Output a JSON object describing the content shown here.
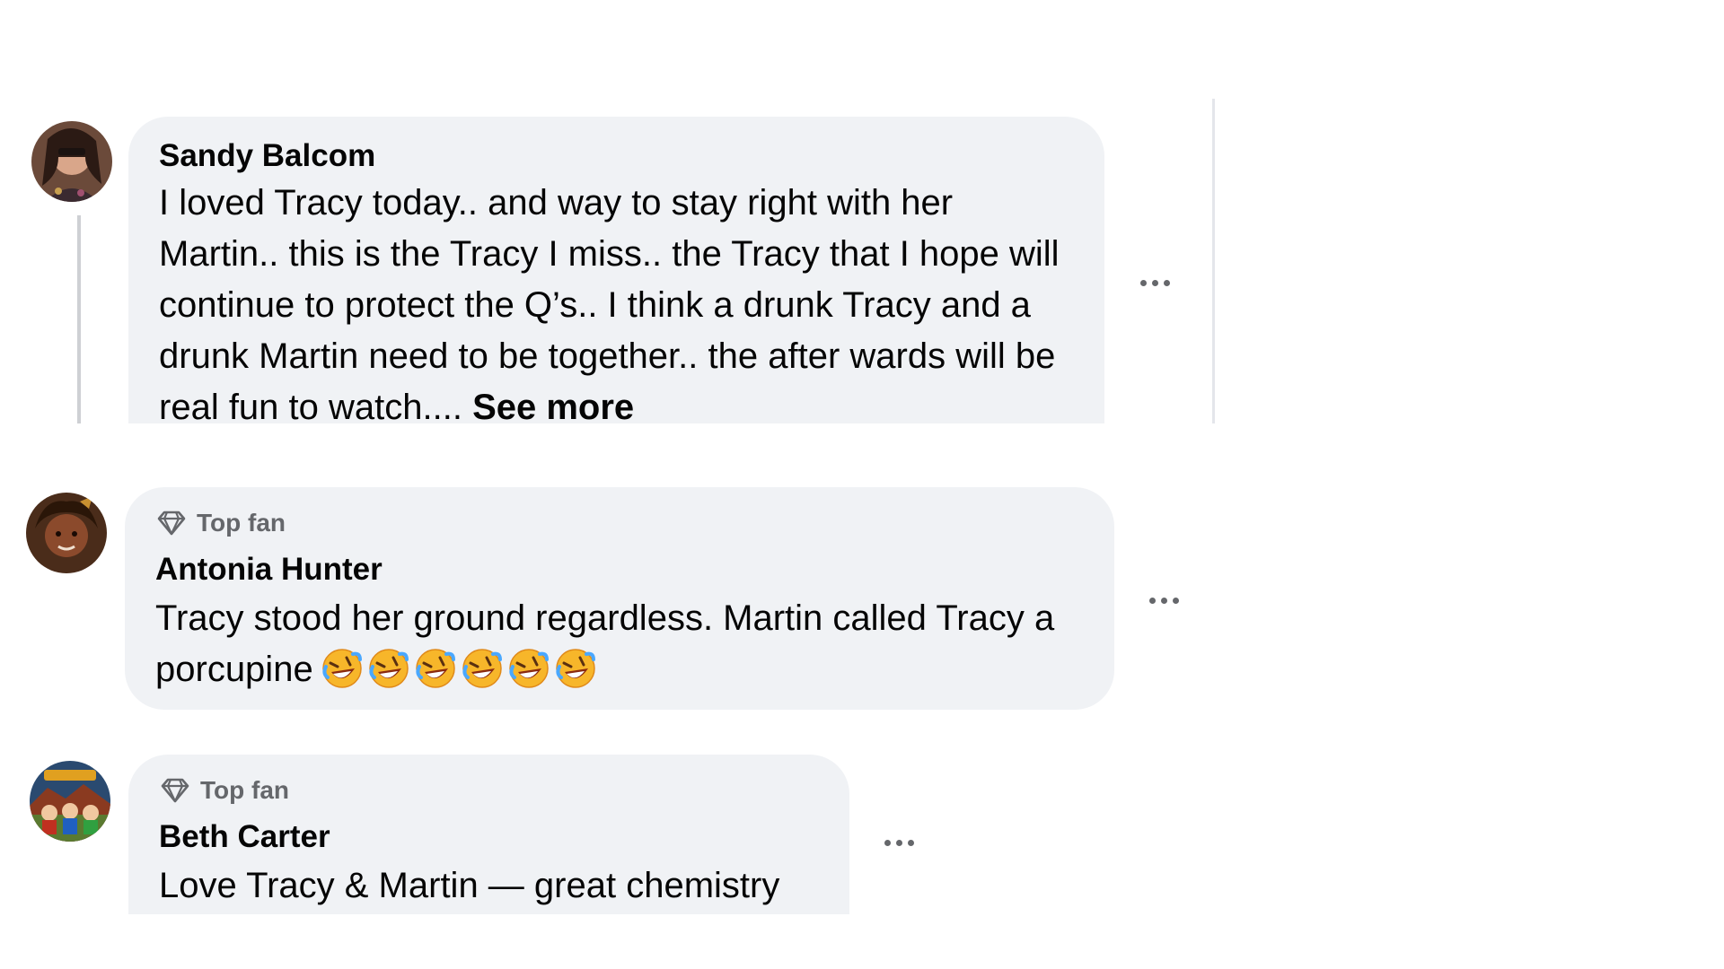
{
  "comments": [
    {
      "author": "Sandy Balcom",
      "text": "I loved Tracy today.. and way to stay right with her Martin.. this is the Tracy I miss.. the Tracy that I hope will continue to protect the Q’s.. I think a drunk Tracy and a drunk Martin need to be together.. the after wards will be real fun to watch.... ",
      "see_more": "See more",
      "badge": null
    },
    {
      "author": "Antonia Hunter",
      "badge": "Top fan",
      "text": "Tracy stood her ground regardless. Martin called Tracy a porcupine",
      "emojis": [
        "rolling-laughing",
        "rolling-laughing",
        "rolling-laughing",
        "rolling-laughing",
        "rolling-laughing",
        "rolling-laughing"
      ]
    },
    {
      "author": "Beth Carter",
      "badge": "Top fan",
      "text": "Love Tracy & Martin — great chemistry"
    }
  ],
  "icons": {
    "badge_icon": "diamond-icon",
    "more_icon": "more-options-icon",
    "emoji_icon": "rolling-on-floor-laughing-emoji"
  },
  "colors": {
    "bubble": "#f0f2f5",
    "secondary_text": "#65676b",
    "primary_text": "#050505"
  }
}
